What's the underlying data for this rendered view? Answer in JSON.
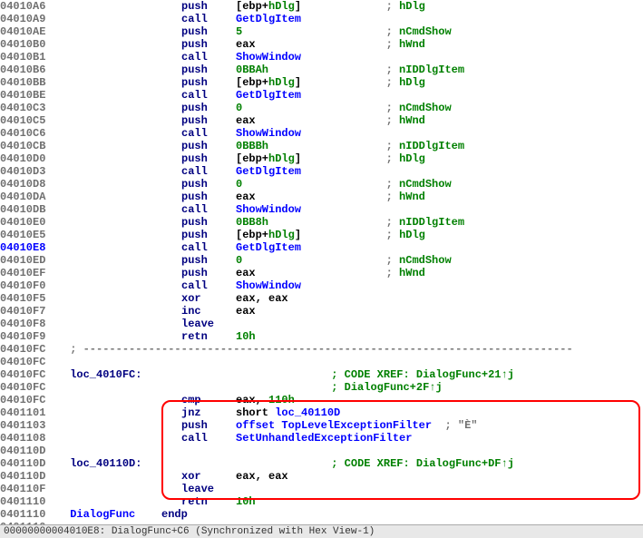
{
  "lines": [
    {
      "addr": "04010A6",
      "col1": "",
      "mnem": "push",
      "ops": [
        {
          "t": "[ebp+",
          "c": "op"
        },
        {
          "t": "hDlg",
          "c": "op-green"
        },
        {
          "t": "]",
          "c": "op"
        }
      ],
      "comment_pad": 13,
      "comment": "; ",
      "ckw": "hDlg"
    },
    {
      "addr": "04010A9",
      "col1": "",
      "mnem": "call",
      "ops": [
        {
          "t": "GetDlgItem",
          "c": "func"
        }
      ]
    },
    {
      "addr": "04010AE",
      "col1": "",
      "mnem": "push",
      "ops": [
        {
          "t": "5",
          "c": "op-num"
        }
      ],
      "comment_pad": 22,
      "comment": "; ",
      "ckw": "nCmdShow"
    },
    {
      "addr": "04010B0",
      "col1": "",
      "mnem": "push",
      "ops": [
        {
          "t": "eax",
          "c": "op"
        }
      ],
      "comment_pad": 20,
      "comment": "; ",
      "ckw": "hWnd"
    },
    {
      "addr": "04010B1",
      "col1": "",
      "mnem": "call",
      "ops": [
        {
          "t": "ShowWindow",
          "c": "func"
        }
      ]
    },
    {
      "addr": "04010B6",
      "col1": "",
      "mnem": "push",
      "ops": [
        {
          "t": "0BBAh",
          "c": "op-num"
        }
      ],
      "comment_pad": 18,
      "comment": "; ",
      "ckw": "nIDDlgItem"
    },
    {
      "addr": "04010BB",
      "col1": "",
      "mnem": "push",
      "ops": [
        {
          "t": "[ebp+",
          "c": "op"
        },
        {
          "t": "hDlg",
          "c": "op-green"
        },
        {
          "t": "]",
          "c": "op"
        }
      ],
      "comment_pad": 13,
      "comment": "; ",
      "ckw": "hDlg"
    },
    {
      "addr": "04010BE",
      "col1": "",
      "mnem": "call",
      "ops": [
        {
          "t": "GetDlgItem",
          "c": "func"
        }
      ]
    },
    {
      "addr": "04010C3",
      "col1": "",
      "mnem": "push",
      "ops": [
        {
          "t": "0",
          "c": "op-num"
        }
      ],
      "comment_pad": 22,
      "comment": "; ",
      "ckw": "nCmdShow"
    },
    {
      "addr": "04010C5",
      "col1": "",
      "mnem": "push",
      "ops": [
        {
          "t": "eax",
          "c": "op"
        }
      ],
      "comment_pad": 20,
      "comment": "; ",
      "ckw": "hWnd"
    },
    {
      "addr": "04010C6",
      "col1": "",
      "mnem": "call",
      "ops": [
        {
          "t": "ShowWindow",
          "c": "func"
        }
      ]
    },
    {
      "addr": "04010CB",
      "col1": "",
      "mnem": "push",
      "ops": [
        {
          "t": "0BBBh",
          "c": "op-num"
        }
      ],
      "comment_pad": 18,
      "comment": "; ",
      "ckw": "nIDDlgItem"
    },
    {
      "addr": "04010D0",
      "col1": "",
      "mnem": "push",
      "ops": [
        {
          "t": "[ebp+",
          "c": "op"
        },
        {
          "t": "hDlg",
          "c": "op-green"
        },
        {
          "t": "]",
          "c": "op"
        }
      ],
      "comment_pad": 13,
      "comment": "; ",
      "ckw": "hDlg"
    },
    {
      "addr": "04010D3",
      "col1": "",
      "mnem": "call",
      "ops": [
        {
          "t": "GetDlgItem",
          "c": "func"
        }
      ]
    },
    {
      "addr": "04010D8",
      "col1": "",
      "mnem": "push",
      "ops": [
        {
          "t": "0",
          "c": "op-num"
        }
      ],
      "comment_pad": 22,
      "comment": "; ",
      "ckw": "nCmdShow"
    },
    {
      "addr": "04010DA",
      "col1": "",
      "mnem": "push",
      "ops": [
        {
          "t": "eax",
          "c": "op"
        }
      ],
      "comment_pad": 20,
      "comment": "; ",
      "ckw": "hWnd"
    },
    {
      "addr": "04010DB",
      "col1": "",
      "mnem": "call",
      "ops": [
        {
          "t": "ShowWindow",
          "c": "func"
        }
      ]
    },
    {
      "addr": "04010E0",
      "col1": "",
      "mnem": "push",
      "ops": [
        {
          "t": "0BB8h",
          "c": "op-num"
        }
      ],
      "comment_pad": 18,
      "comment": "; ",
      "ckw": "nIDDlgItem"
    },
    {
      "addr": "04010E5",
      "col1": "",
      "mnem": "push",
      "ops": [
        {
          "t": "[ebp+",
          "c": "op"
        },
        {
          "t": "hDlg",
          "c": "op-green"
        },
        {
          "t": "]",
          "c": "op"
        }
      ],
      "comment_pad": 13,
      "comment": "; ",
      "ckw": "hDlg"
    },
    {
      "addr": "04010E8",
      "hl": true,
      "col1": "",
      "mnem": "call",
      "ops": [
        {
          "t": "GetDlgItem",
          "c": "func"
        }
      ]
    },
    {
      "addr": "04010ED",
      "col1": "",
      "mnem": "push",
      "ops": [
        {
          "t": "0",
          "c": "op-num"
        }
      ],
      "comment_pad": 22,
      "comment": "; ",
      "ckw": "nCmdShow"
    },
    {
      "addr": "04010EF",
      "col1": "",
      "mnem": "push",
      "ops": [
        {
          "t": "eax",
          "c": "op"
        }
      ],
      "comment_pad": 20,
      "comment": "; ",
      "ckw": "hWnd"
    },
    {
      "addr": "04010F0",
      "col1": "",
      "mnem": "call",
      "ops": [
        {
          "t": "ShowWindow",
          "c": "func"
        }
      ]
    },
    {
      "addr": "04010F5",
      "col1": "",
      "mnem": "xor",
      "ops": [
        {
          "t": "eax, eax",
          "c": "op"
        }
      ]
    },
    {
      "addr": "04010F7",
      "col1": "",
      "mnem": "inc",
      "ops": [
        {
          "t": "eax",
          "c": "op"
        }
      ]
    },
    {
      "addr": "04010F8",
      "col1": "",
      "mnem": "leave",
      "ops": []
    },
    {
      "addr": "04010F9",
      "col1": "",
      "mnem": "retn",
      "ops": [
        {
          "t": "10h",
          "c": "op-num"
        }
      ]
    },
    {
      "addr": "04010FC",
      "special": "dashes"
    },
    {
      "addr": "04010FC",
      "blank": true
    },
    {
      "addr": "04010FC",
      "label": "loc_4010FC:",
      "xref": "; CODE XREF: DialogFunc+21↑j"
    },
    {
      "addr": "04010FC",
      "xref_only": "; DialogFunc+2F↑j"
    },
    {
      "addr": "04010FC",
      "col1": "",
      "mnem": "cmp",
      "ops": [
        {
          "t": "eax, ",
          "c": "op"
        },
        {
          "t": "110h",
          "c": "op-num"
        }
      ]
    },
    {
      "addr": "0401101",
      "col1": "",
      "mnem": "jnz",
      "ops": [
        {
          "t": "short ",
          "c": "op"
        },
        {
          "t": "loc_40110D",
          "c": "func"
        }
      ]
    },
    {
      "addr": "0401103",
      "col1": "",
      "mnem": "push",
      "ops": [
        {
          "t": "offset ",
          "c": "op-blue"
        },
        {
          "t": "TopLevelExceptionFilter",
          "c": "func"
        }
      ],
      "comment_pad": 1,
      "comment": " ; \"È\""
    },
    {
      "addr": "0401108",
      "col1": "",
      "mnem": "call",
      "ops": [
        {
          "t": "SetUnhandledExceptionFilter",
          "c": "func"
        }
      ]
    },
    {
      "addr": "040110D",
      "blank": true
    },
    {
      "addr": "040110D",
      "label": "loc_40110D:",
      "xref": "; CODE XREF: DialogFunc+DF↑j"
    },
    {
      "addr": "040110D",
      "col1": "",
      "mnem": "xor",
      "ops": [
        {
          "t": "eax, eax",
          "c": "op"
        }
      ]
    },
    {
      "addr": "040110F",
      "col1": "",
      "mnem": "leave",
      "ops": []
    },
    {
      "addr": "0401110",
      "col1": "",
      "mnem": "retn",
      "ops": [
        {
          "t": "10h",
          "c": "op-num"
        }
      ]
    },
    {
      "addr": "0401110",
      "label_proc": "DialogFunc",
      "endp": "endp"
    },
    {
      "addr": "0401110",
      "blank": true
    }
  ],
  "statusbar": "  00000000004010E8: DialogFunc+C6  (Synchronized with Hex View-1)",
  "dash_text": "; ---------------------------------------------------------------------------"
}
